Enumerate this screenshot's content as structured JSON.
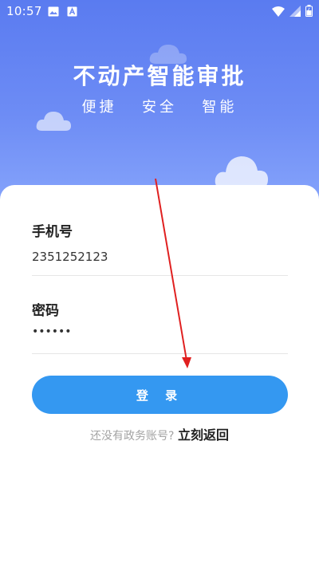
{
  "status_bar": {
    "time": "10:57",
    "left_icons": [
      "image-icon",
      "text-a-icon"
    ],
    "right_icons": [
      "wifi-icon",
      "signal-icon",
      "battery-icon"
    ]
  },
  "header": {
    "title": "不动产智能审批",
    "subtitle": "便捷  安全  智能"
  },
  "form": {
    "phone_label": "手机号",
    "phone_value": "2351252123",
    "password_label": "密码",
    "password_value": "••••••"
  },
  "login_button": {
    "label": "登 录"
  },
  "register": {
    "prompt": "还没有政务账号?",
    "link": "立刻返回"
  },
  "colors": {
    "hero_gradient_top": "#5a7bf0",
    "hero_gradient_bottom": "#86a4fb",
    "button": "#3498f1",
    "annotation_arrow": "#e02020"
  }
}
